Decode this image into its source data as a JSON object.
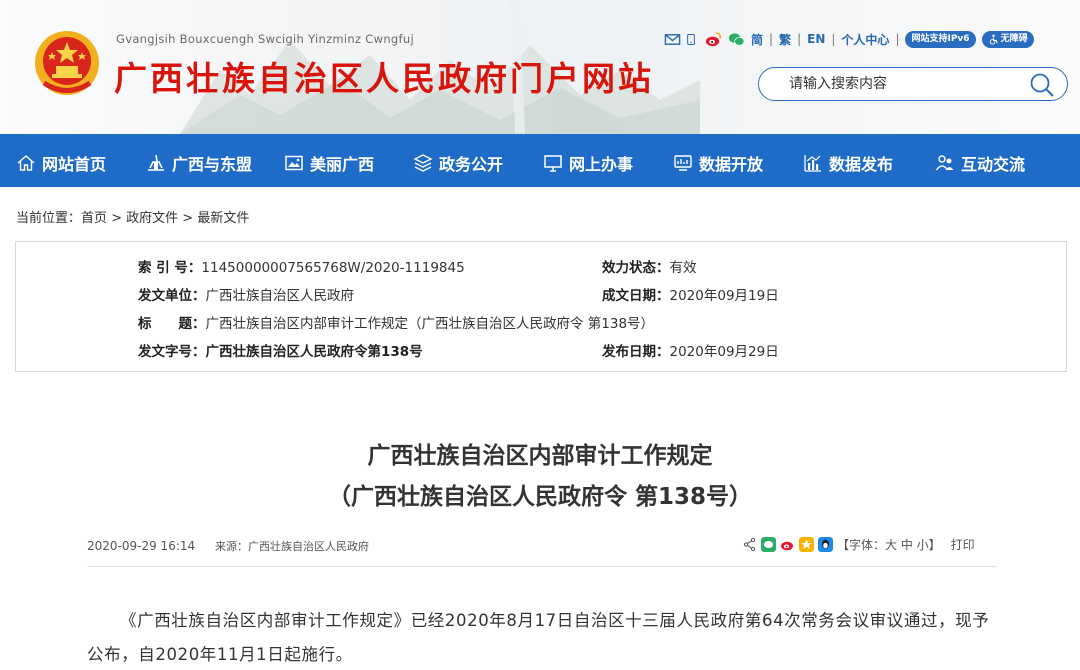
{
  "header": {
    "pinyin": "Gvangjsih Bouxcuengh Swcigih Yinzminz Cwngfuj",
    "site_title": "广西壮族自治区人民政府门户网站",
    "links": {
      "simplified": "简",
      "traditional": "繁",
      "english": "EN",
      "personal": "个人中心"
    },
    "badges": {
      "ipv6": "网站支持IPv6",
      "accessible": "无障碍"
    },
    "search_placeholder": "请输入搜索内容"
  },
  "nav": [
    {
      "label": "网站首页",
      "icon": "home-icon"
    },
    {
      "label": "广西与东盟",
      "icon": "building-icon"
    },
    {
      "label": "美丽广西",
      "icon": "photo-icon"
    },
    {
      "label": "政务公开",
      "icon": "layers-icon"
    },
    {
      "label": "网上办事",
      "icon": "monitor-icon"
    },
    {
      "label": "数据开放",
      "icon": "data-icon"
    },
    {
      "label": "数据发布",
      "icon": "chart-icon"
    },
    {
      "label": "互动交流",
      "icon": "people-icon"
    }
  ],
  "breadcrumb": "当前位置：首页 > 政府文件 > 最新文件",
  "info": {
    "index_label": "索 引 号：",
    "index_value": "11450000007565768W/2020-1119845",
    "status_label": "效力状态：",
    "status_value": "有效",
    "issuer_label": "发文单位：",
    "issuer_value": "广西壮族自治区人民政府",
    "written_label": "成文日期：",
    "written_value": "2020年09月19日",
    "title_label": "标　　题：",
    "title_value": "广西壮族自治区内部审计工作规定（广西壮族自治区人民政府令 第138号）",
    "docno_label": "发文字号：",
    "docno_value": "广西壮族自治区人民政府令第138号",
    "published_label": "发布日期：",
    "published_value": "2020年09月29日"
  },
  "article": {
    "title_line1": "广西壮族自治区内部审计工作规定",
    "title_line2": "（广西壮族自治区人民政府令 第138号）",
    "datetime": "2020-09-29 16:14",
    "source": "来源：广西壮族自治区人民政府",
    "font_size": "【字体：大 中 小】",
    "print": "打印",
    "body": "《广西壮族自治区内部审计工作规定》已经2020年8月17日自治区十三届人民政府第64次常务会议审议通过，现予公布，自2020年11月1日起施行。"
  },
  "colors": {
    "brand_red": "#d8140b",
    "nav_blue": "#1f6bc8",
    "link_blue": "#2769b0"
  }
}
